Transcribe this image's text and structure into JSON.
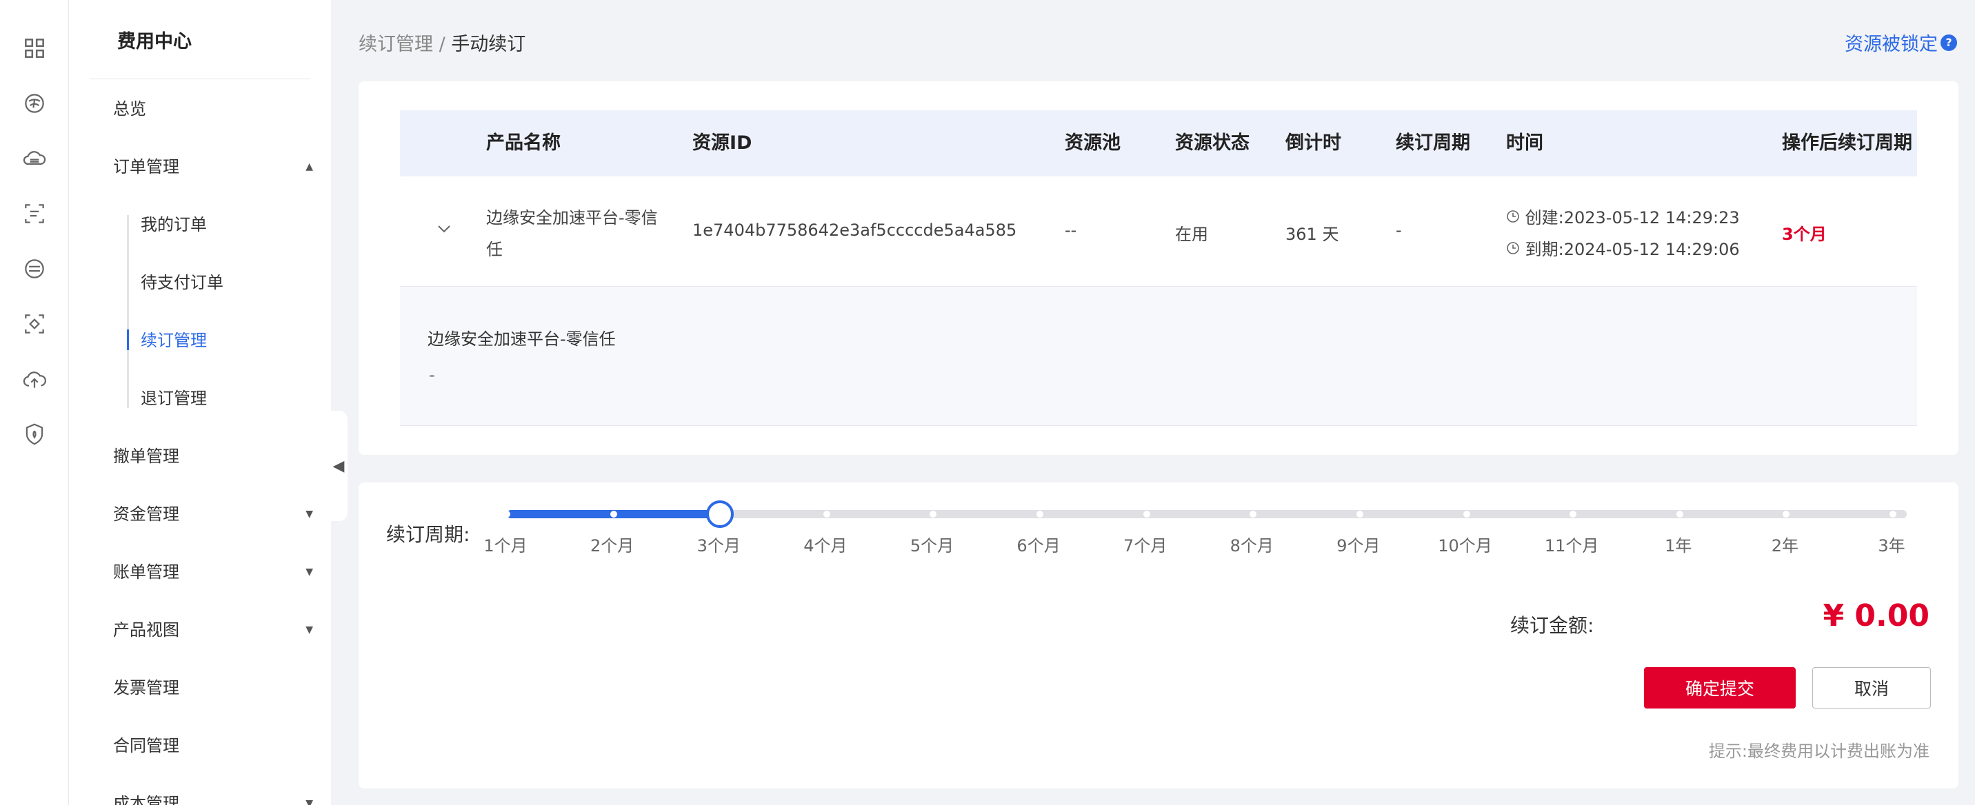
{
  "sidebar": {
    "title": "费用中心",
    "items": [
      {
        "label": "总览"
      },
      {
        "label": "订单管理",
        "arrow": "▲"
      },
      {
        "label": "撤单管理"
      },
      {
        "label": "资金管理",
        "arrow": "▼"
      },
      {
        "label": "账单管理",
        "arrow": "▼"
      },
      {
        "label": "产品视图",
        "arrow": "▼"
      },
      {
        "label": "发票管理"
      },
      {
        "label": "合同管理"
      },
      {
        "label": "成本管理",
        "arrow": "▼"
      }
    ],
    "subitems": [
      {
        "label": "我的订单"
      },
      {
        "label": "待支付订单"
      },
      {
        "label": "续订管理"
      },
      {
        "label": "退订管理"
      }
    ]
  },
  "header": {
    "breadcrumb_parent": "续订管理",
    "breadcrumb_sep": "/",
    "breadcrumb_current": "手动续订",
    "locked_link": "资源被锁定",
    "help_glyph": "?"
  },
  "table": {
    "columns": [
      "产品名称",
      "资源ID",
      "资源池",
      "资源状态",
      "倒计时",
      "续订周期",
      "时间",
      "操作后续订周期"
    ],
    "row": {
      "name_line1": "边缘安全加速平台-零信",
      "name_line2": "任",
      "resource_id": "1e7404b7758642e3af5ccccde5a4a585",
      "pool": "--",
      "status": "在用",
      "countdown": "361 天",
      "period": "-",
      "created": "创建:2023-05-12 14:29:23",
      "expires": "到期:2024-05-12 14:29:06",
      "after_period": "3个月"
    },
    "expand": {
      "title": "边缘安全加速平台-零信任",
      "detail": "-"
    }
  },
  "renew": {
    "label": "续订周期:",
    "ticks": [
      "1个月",
      "2个月",
      "3个月",
      "4个月",
      "5个月",
      "6个月",
      "7个月",
      "8个月",
      "9个月",
      "10个月",
      "11个月",
      "1年",
      "2年",
      "3年"
    ],
    "selected_index": 2,
    "amount_label": "续订金额:",
    "amount": "¥ 0.00",
    "submit": "确定提交",
    "cancel": "取消",
    "hint": "提示:最终费用以计费出账为准"
  },
  "colors": {
    "accent": "#2c6ae6",
    "danger": "#e0002b"
  },
  "icons": [
    "grid-icon",
    "globe-icon",
    "cloud-server-icon",
    "scan-icon",
    "storage-icon",
    "focus-icon",
    "cloud-upload-icon",
    "shield-icon"
  ]
}
